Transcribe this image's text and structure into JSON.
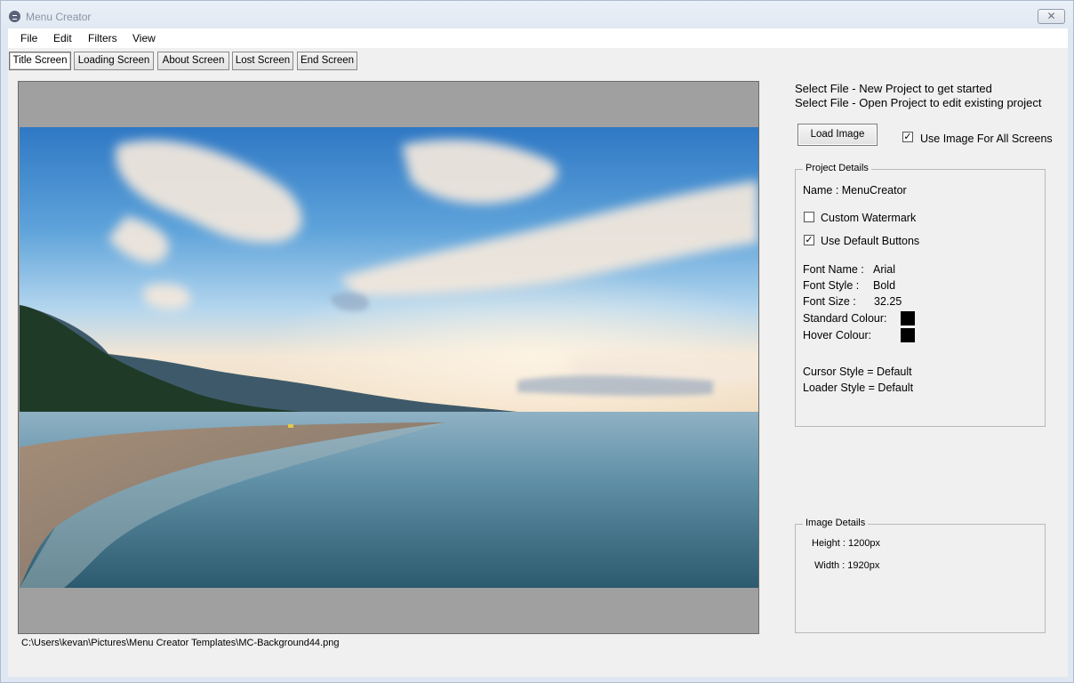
{
  "window": {
    "title": "Menu Creator",
    "close_glyph": "✕"
  },
  "menu": [
    "File",
    "Edit",
    "Filters",
    "View"
  ],
  "tabs": [
    "Title Screen",
    "Loading Screen",
    "About Screen",
    "Lost Screen",
    "End Screen"
  ],
  "active_tab": "Title Screen",
  "preview": {
    "file_path": "C:\\Users\\kevan\\Pictures\\Menu Creator Templates\\MC-Background44.png"
  },
  "instructions": [
    "Select File - New Project to get started",
    "Select File - Open Project to edit existing project"
  ],
  "load_image_label": "Load Image",
  "use_image_all": {
    "label": "Use Image For All Screens",
    "checked": true
  },
  "project": {
    "title": "Project Details",
    "name": "Name : MenuCreator",
    "custom_watermark": {
      "label": "Custom Watermark",
      "checked": false
    },
    "use_default_buttons": {
      "label": "Use Default Buttons",
      "checked": true
    },
    "font_name_label": "Font Name :",
    "font_name": "Arial",
    "font_style_label": "Font Style :",
    "font_style": "Bold",
    "font_size_label": "Font Size :",
    "font_size": "32.25",
    "standard_colour_label": "Standard Colour:",
    "standard_colour": "#000000",
    "hover_colour_label": "Hover Colour:",
    "hover_colour": "#000000",
    "cursor_style": "Cursor Style = Default",
    "loader_style": "Loader Style = Default"
  },
  "image_details": {
    "title": "Image Details",
    "height": "Height : 1200px",
    "width": "Width : 1920px"
  },
  "check_glyph": "✓"
}
